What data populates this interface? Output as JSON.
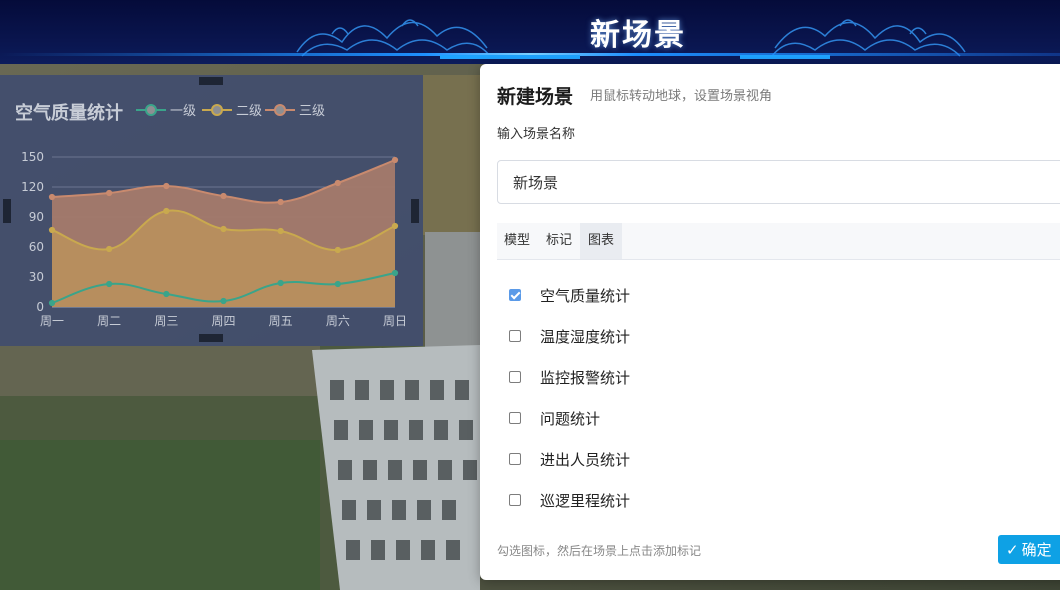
{
  "header": {
    "title": "新场景"
  },
  "chart_panel": {
    "title": "空气质量统计",
    "legend": [
      {
        "name": "一级",
        "color": "#3aa48a"
      },
      {
        "name": "二级",
        "color": "#c9a94e"
      },
      {
        "name": "三级",
        "color": "#c98a6e"
      }
    ]
  },
  "chart_data": {
    "type": "area",
    "title": "空气质量统计",
    "categories": [
      "周一",
      "周二",
      "周三",
      "周四",
      "周五",
      "周六",
      "周日"
    ],
    "yticks": [
      "0",
      "30",
      "60",
      "90",
      "120",
      "150"
    ],
    "ylim": [
      0,
      150
    ],
    "smooth": true,
    "series": [
      {
        "name": "三级",
        "values": [
          110,
          114,
          121,
          111,
          105,
          124,
          147
        ],
        "color": "#c98a6e",
        "fill": "#a57a6c"
      },
      {
        "name": "二级",
        "values": [
          77,
          58,
          96,
          78,
          76,
          57,
          81
        ],
        "color": "#c9a94e",
        "fill": "#b88f5e"
      },
      {
        "name": "一级",
        "values": [
          4,
          23,
          13,
          6,
          24,
          23,
          34
        ],
        "color": "#3aa48a",
        "fill": "none"
      }
    ],
    "grid": true
  },
  "dialog": {
    "title": "新建场景",
    "hint": "用鼠标转动地球，设置场景视角",
    "name_label": "输入场景名称",
    "name_value": "新场景",
    "tabs": [
      {
        "label": "模型",
        "active": false
      },
      {
        "label": "标记",
        "active": false
      },
      {
        "label": "图表",
        "active": true
      }
    ],
    "options": [
      {
        "label": "空气质量统计",
        "checked": true
      },
      {
        "label": "温度湿度统计",
        "checked": false
      },
      {
        "label": "监控报警统计",
        "checked": false
      },
      {
        "label": "问题统计",
        "checked": false
      },
      {
        "label": "进出人员统计",
        "checked": false
      },
      {
        "label": "巡逻里程统计",
        "checked": false
      }
    ],
    "footer_hint": "勾选图标，然后在场景上点击添加标记",
    "confirm_label": "确定"
  }
}
